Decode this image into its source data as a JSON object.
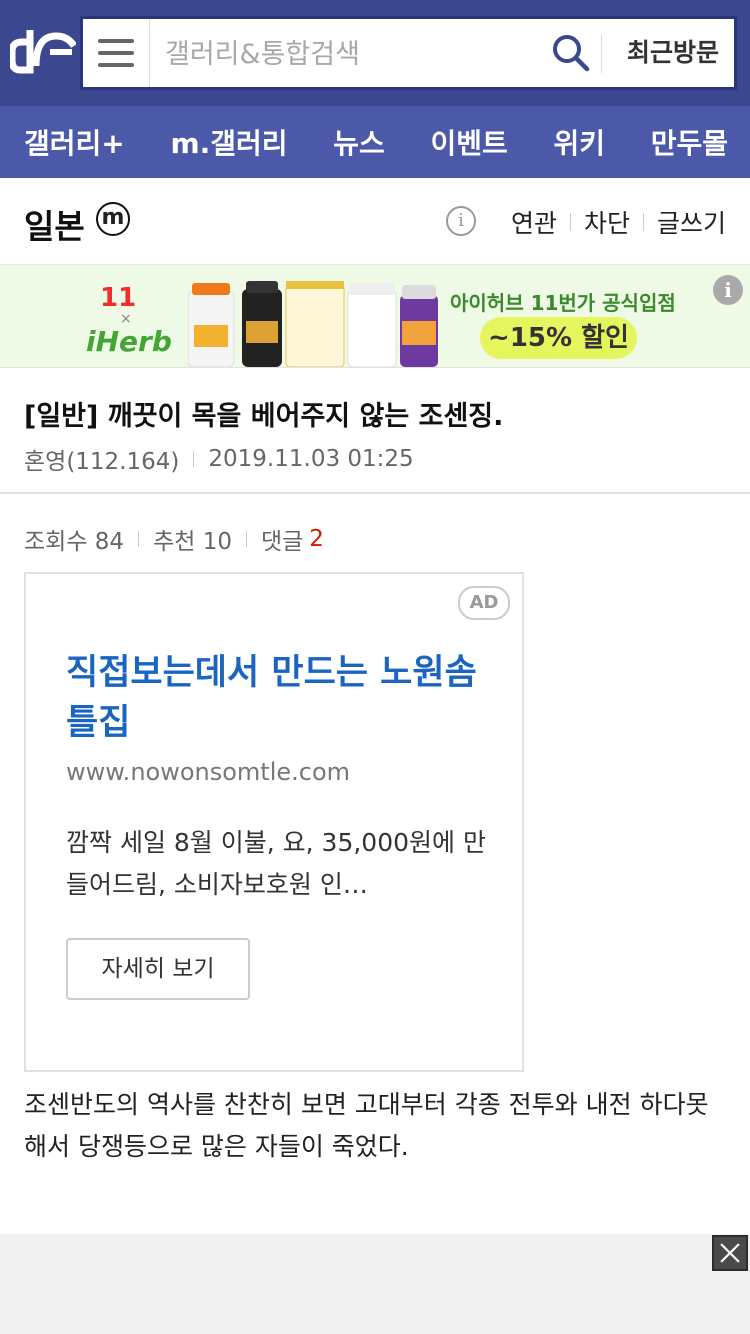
{
  "header": {
    "logo_name": "dc-logo",
    "search_placeholder": "갤러리&통합검색",
    "recent_label": "최근방문"
  },
  "nav": {
    "items": [
      {
        "label": "갤러리+"
      },
      {
        "label": "m.갤러리"
      },
      {
        "label": "뉴스"
      },
      {
        "label": "이벤트"
      },
      {
        "label": "위키"
      },
      {
        "label": "만두몰"
      }
    ]
  },
  "gallery": {
    "title": "일본",
    "badge": "m",
    "info_glyph": "i",
    "actions": {
      "related": "연관",
      "block": "차단",
      "write": "글쓰기"
    }
  },
  "banner": {
    "brand_top": "11",
    "brand_x": "×",
    "brand_bottom": "iHerb",
    "text": "아이허브 11번가 공식입점",
    "discount": "~15% 할인",
    "info_glyph": "i"
  },
  "post": {
    "title": "[일반] 깨끗이 목을 베어주지 않는 조센징.",
    "author": "혼영(112.164)",
    "date": "2019.11.03 01:25",
    "stats": {
      "views_label": "조회수 84",
      "recommend_label": "추천 10",
      "comments_label": "댓글",
      "comments_count": "2"
    },
    "body": "조센반도의 역사를 찬찬히 보면 고대부터 각종 전투와 내전 하다못해서 당쟁등으로 많은 자들이 죽었다."
  },
  "ad": {
    "badge": "AD",
    "title": "직접보는데서 만드는 노원솜틀집",
    "url": "www.nowonsomtle.com",
    "description": "깜짝 세일 8월 이불, 요, 35,000원에 만들어드림, 소비자보호원 인…",
    "button": "자세히 보기"
  },
  "colors": {
    "header_bg": "#3b4890",
    "nav_bg": "#4b59a8",
    "ad_title": "#1a65c1",
    "comment_count": "#d31900"
  }
}
